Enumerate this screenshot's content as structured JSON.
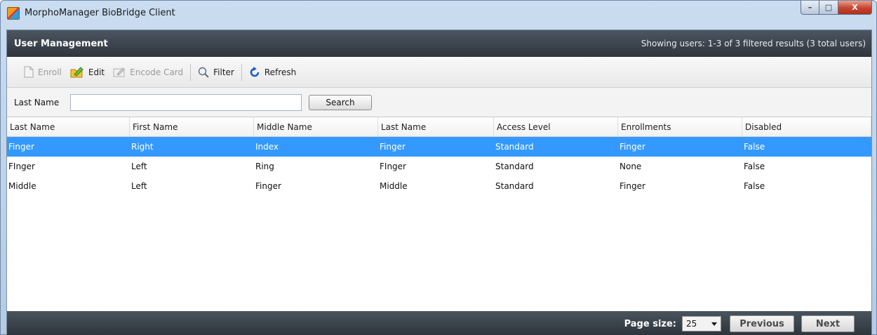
{
  "window": {
    "title": "MorphoManager BioBridge Client",
    "controls": {
      "minimize": "–",
      "maximize": "□",
      "close": "X"
    }
  },
  "header": {
    "title": "User Management",
    "status": "Showing users: 1-3 of 3 filtered results (3 total users)"
  },
  "toolbar": {
    "enroll": "Enroll",
    "edit": "Edit",
    "encode_card": "Encode Card",
    "filter": "Filter",
    "refresh": "Refresh"
  },
  "search": {
    "label": "Last Name",
    "value": "",
    "placeholder": "",
    "button": "Search"
  },
  "table": {
    "columns": [
      "Last Name",
      "First Name",
      "Middle Name",
      "Last Name",
      "Access Level",
      "Enrollments",
      "Disabled"
    ],
    "rows": [
      [
        "Finger",
        "Right",
        "Index",
        "Finger",
        "Standard",
        "Finger",
        "False"
      ],
      [
        "FInger",
        "Left",
        "Ring",
        "FInger",
        "Standard",
        "None",
        "False"
      ],
      [
        "Middle",
        "Left",
        "Finger",
        "Middle",
        "Standard",
        "Finger",
        "False"
      ]
    ],
    "selected_row": 0
  },
  "footer": {
    "page_size_label": "Page size:",
    "page_size_value": "25",
    "previous": "Previous",
    "next": "Next"
  },
  "colors": {
    "selection": "#3399ff",
    "header_bar": "#3a424b",
    "refresh_icon": "#1f5fbf"
  }
}
